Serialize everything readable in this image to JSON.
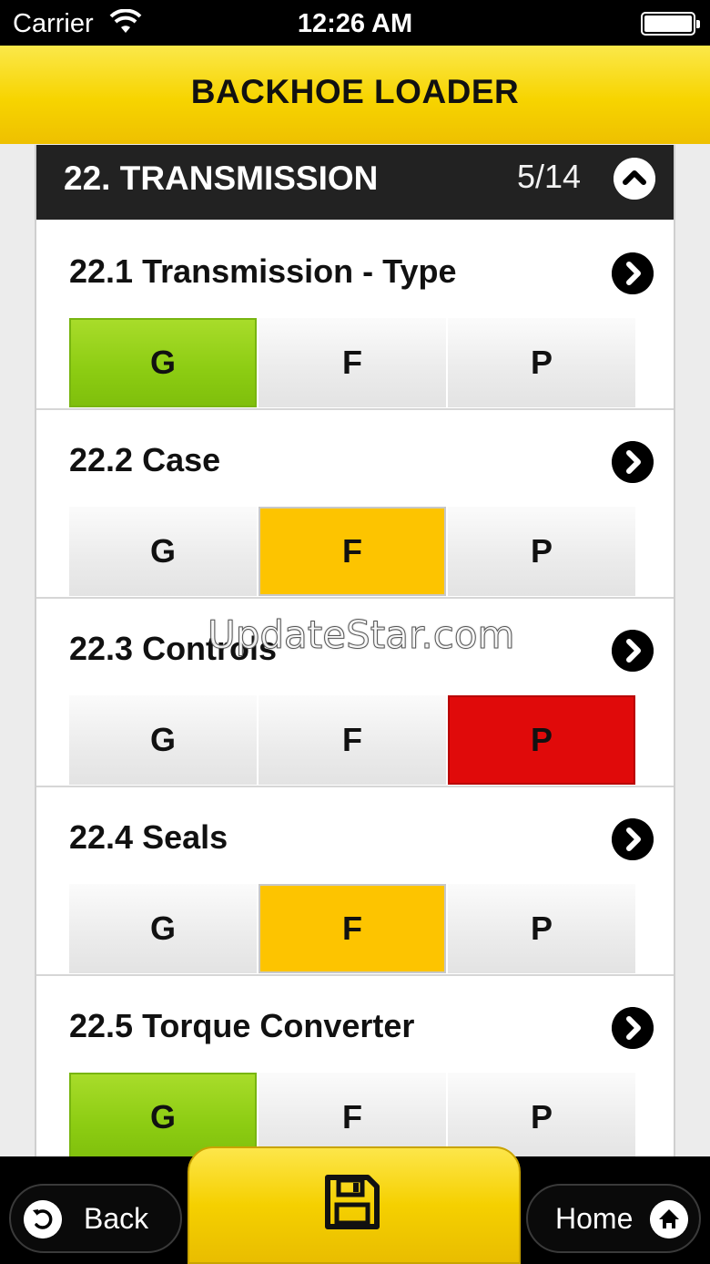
{
  "status_bar": {
    "carrier": "Carrier",
    "time": "12:26 AM"
  },
  "header": {
    "title": "BACKHOE LOADER"
  },
  "section": {
    "title": "22. TRANSMISSION",
    "count": "5/14"
  },
  "items": [
    {
      "title": "22.1 Transmission - Type",
      "options": [
        "G",
        "F",
        "P"
      ],
      "selected": "G"
    },
    {
      "title": "22.2 Case",
      "options": [
        "G",
        "F",
        "P"
      ],
      "selected": "F"
    },
    {
      "title": "22.3 Controls",
      "options": [
        "G",
        "F",
        "P"
      ],
      "selected": "P"
    },
    {
      "title": "22.4 Seals",
      "options": [
        "G",
        "F",
        "P"
      ],
      "selected": "F"
    },
    {
      "title": "22.5 Torque Converter",
      "options": [
        "G",
        "F",
        "P"
      ],
      "selected": "G"
    }
  ],
  "watermark": "UpdateStar.com",
  "footer": {
    "back_label": "Back",
    "home_label": "Home",
    "save_icon": "save-icon"
  },
  "colors": {
    "header_yellow": "#f7d400",
    "good_green": "#8ccc12",
    "fair_amber": "#fdc400",
    "poor_red": "#e00a0a"
  }
}
